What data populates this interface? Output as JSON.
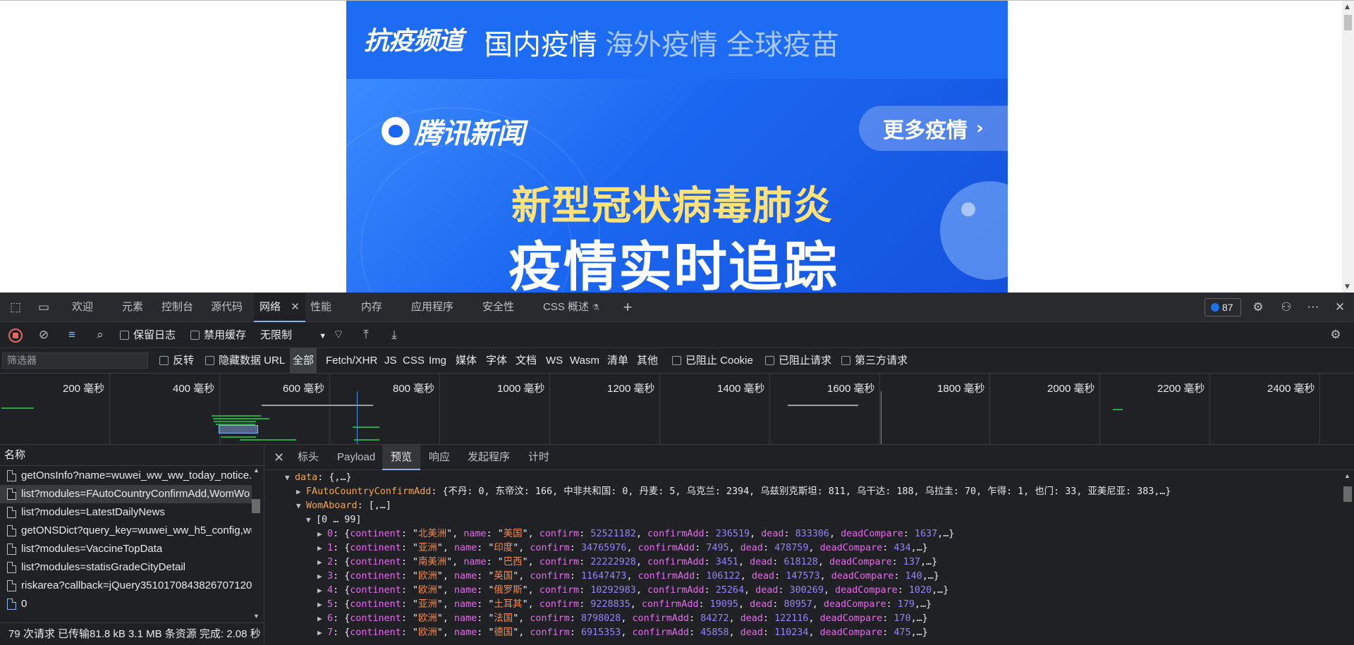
{
  "page": {
    "crumb": "抗疫频道",
    "chevron": "›",
    "tabs": [
      "国内疫情",
      "海外疫情",
      "全球疫苗"
    ],
    "logo_text": "腾讯新闻",
    "more_button": "更多疫情",
    "more_arrow": "›",
    "headline_line1": "新型冠状病毒肺炎",
    "headline_line2": "疫情实时追踪"
  },
  "devtools": {
    "panels": [
      "欢迎",
      "元素",
      "控制台",
      "源代码",
      "网络",
      "性能",
      "内存",
      "应用程序",
      "安全性",
      "CSS 概述"
    ],
    "active_panel": "网络",
    "issues_count": "87",
    "toolbar": {
      "preserve_log": "保留日志",
      "disable_cache": "禁用缓存",
      "throttling": "无限制"
    },
    "filter": {
      "placeholder": "筛选器",
      "invert": "反转",
      "hide_data_urls": "隐藏数据 URL",
      "types": [
        "全部",
        "Fetch/XHR",
        "JS",
        "CSS",
        "Img",
        "媒体",
        "字体",
        "文档",
        "WS",
        "Wasm",
        "清单",
        "其他"
      ],
      "blocked_cookies": "已阻止 Cookie",
      "blocked_requests": "已阻止请求",
      "third_party": "第三方请求"
    },
    "timeline_ticks": [
      "200 毫秒",
      "400 毫秒",
      "600 毫秒",
      "800 毫秒",
      "1000 毫秒",
      "1200 毫秒",
      "1400 毫秒",
      "1600 毫秒",
      "1800 毫秒",
      "2000 毫秒",
      "2200 毫秒",
      "2400 毫秒"
    ],
    "request_list": {
      "header": "名称",
      "rows": [
        "getOnsInfo?name=wuwei_ww_ww_today_notice...",
        "list?modules=FAutoCountryConfirmAdd,WomWo",
        "list?modules=LatestDailyNews",
        "getONSDict?query_key=wuwei_ww_h5_config,wu",
        "list?modules=VaccineTopData",
        "list?modules=statisGradeCityDetail",
        "riskarea?callback=jQuery3510170843826707120",
        "0"
      ],
      "status": "79 次请求  已传输81.8 kB  3.1 MB 条资源  完成: 2.08 秒"
    },
    "detail_tabs": [
      "标头",
      "Payload",
      "预览",
      "响应",
      "发起程序",
      "计时"
    ],
    "active_detail_tab": "预览",
    "preview": {
      "data_key": "data",
      "data_summary": "{,…}",
      "fauto_key": "FAutoCountryConfirmAdd",
      "fauto_value": "{不丹: 0, 东帝汶: 166, 中非共和国: 0, 丹麦: 5, 乌克兰: 2394, 乌兹别克斯坦: 811, 乌干达: 188, 乌拉圭: 70, 乍得: 1, 也门: 33, 亚美尼亚: 383,…}",
      "wom_key": "WomAboard",
      "wom_summary": "[,…]",
      "range": "[0 … 99]",
      "items": [
        {
          "idx": "0",
          "continent": "北美洲",
          "name": "美国",
          "confirm": "52521182",
          "confirmAdd": "236519",
          "dead": "833306",
          "deadCompare": "1637"
        },
        {
          "idx": "1",
          "continent": "亚洲",
          "name": "印度",
          "confirm": "34765976",
          "confirmAdd": "7495",
          "dead": "478759",
          "deadCompare": "434"
        },
        {
          "idx": "2",
          "continent": "南美洲",
          "name": "巴西",
          "confirm": "22222928",
          "confirmAdd": "3451",
          "dead": "618128",
          "deadCompare": "137"
        },
        {
          "idx": "3",
          "continent": "欧洲",
          "name": "英国",
          "confirm": "11647473",
          "confirmAdd": "106122",
          "dead": "147573",
          "deadCompare": "140"
        },
        {
          "idx": "4",
          "continent": "欧洲",
          "name": "俄罗斯",
          "confirm": "10292983",
          "confirmAdd": "25264",
          "dead": "300269",
          "deadCompare": "1020"
        },
        {
          "idx": "5",
          "continent": "亚洲",
          "name": "土耳其",
          "confirm": "9228835",
          "confirmAdd": "19095",
          "dead": "80957",
          "deadCompare": "179"
        },
        {
          "idx": "6",
          "continent": "欧洲",
          "name": "法国",
          "confirm": "8798028",
          "confirmAdd": "84272",
          "dead": "122116",
          "deadCompare": "170"
        },
        {
          "idx": "7",
          "continent": "欧洲",
          "name": "德国",
          "confirm": "6915353",
          "confirmAdd": "45858",
          "dead": "110234",
          "deadCompare": "475"
        }
      ]
    }
  }
}
